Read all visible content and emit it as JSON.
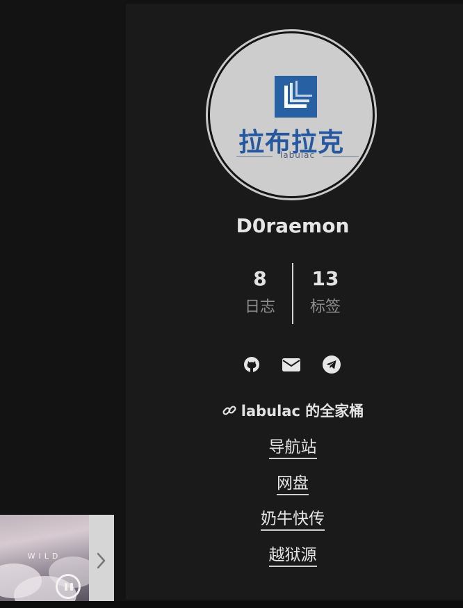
{
  "author": {
    "name": "D0raemon",
    "avatar_logo": {
      "cn": "拉布拉克",
      "en": "labulac"
    }
  },
  "stats": [
    {
      "count": "8",
      "label": "日志"
    },
    {
      "count": "13",
      "label": "标签"
    }
  ],
  "social": [
    {
      "icon": "github-icon"
    },
    {
      "icon": "envelope-icon"
    },
    {
      "icon": "telegram-icon"
    }
  ],
  "links": {
    "title": "labulac 的全家桶",
    "title_icon": "link-icon",
    "items": [
      {
        "label": "导航站"
      },
      {
        "label": "网盘"
      },
      {
        "label": "奶牛快传"
      },
      {
        "label": "越狱源"
      }
    ]
  },
  "player": {
    "cover_text": "WILD",
    "state_icon": "pause-icon",
    "expand_icon": "chevron-right-icon"
  },
  "colors": {
    "background": "#131313",
    "panel": "#1a1a1a",
    "text": "#e5e5e5",
    "muted": "#8e8e8e",
    "logo_blue": "#2860a4"
  }
}
